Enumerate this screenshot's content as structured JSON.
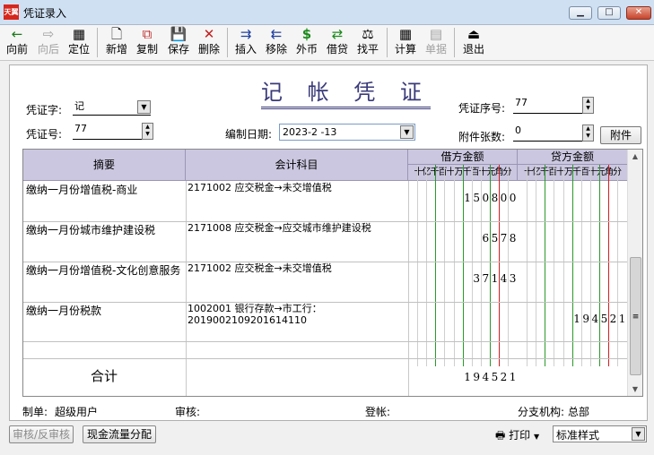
{
  "window": {
    "title": "凭证录入",
    "logo_text": "天翼"
  },
  "toolbar": [
    {
      "key": "back",
      "label": "向前",
      "icon": "←"
    },
    {
      "key": "forward",
      "label": "向后",
      "icon": "⇨",
      "disabled": true
    },
    {
      "key": "locate",
      "label": "定位",
      "icon": "▦"
    },
    {
      "key": "new",
      "label": "新增",
      "icon": "🗋"
    },
    {
      "key": "copy",
      "label": "复制",
      "icon": "⧉"
    },
    {
      "key": "save",
      "label": "保存",
      "icon": "💾"
    },
    {
      "key": "delete",
      "label": "删除",
      "icon": "✕"
    },
    {
      "key": "insert",
      "label": "插入",
      "icon": "⇉"
    },
    {
      "key": "remove",
      "label": "移除",
      "icon": "⇇"
    },
    {
      "key": "forex",
      "label": "外币",
      "icon": "$"
    },
    {
      "key": "debit",
      "label": "借贷",
      "icon": "⇄"
    },
    {
      "key": "balance",
      "label": "找平",
      "icon": "⚖"
    },
    {
      "key": "calc",
      "label": "计算",
      "icon": "▦"
    },
    {
      "key": "receipt",
      "label": "单据",
      "icon": "▤",
      "disabled": true
    },
    {
      "key": "exit",
      "label": "退出",
      "icon": "⏏"
    }
  ],
  "voucher": {
    "title": "记 帐 凭 证",
    "word_label": "凭证字:",
    "word_value": "记",
    "seq_label": "凭证序号:",
    "seq_value": "77",
    "no_label": "凭证号:",
    "no_value": "77",
    "date_label": "编制日期:",
    "date_value": "2023-2 -13",
    "attach_label": "附件张数:",
    "attach_value": "0",
    "attach_button": "附件"
  },
  "table": {
    "headers": {
      "summary": "摘要",
      "account": "会计科目",
      "debit": "借方金额",
      "credit": "贷方金额"
    },
    "digit_headers": [
      "十",
      "亿",
      "千",
      "百",
      "十",
      "万",
      "千",
      "百",
      "十",
      "元",
      "角",
      "分"
    ],
    "rows": [
      {
        "summary": "缴纳一月份增值税-商业",
        "account": "2171002  应交税金→未交增值税",
        "debit": "150800",
        "credit": ""
      },
      {
        "summary": "缴纳一月份城市维护建设税",
        "account": "2171008  应交税金→应交城市维护建设税",
        "debit": "6578",
        "credit": ""
      },
      {
        "summary": "缴纳一月份增值税-文化创意服务",
        "account": "2171002  应交税金→未交增值税",
        "debit": "37143",
        "credit": ""
      },
      {
        "summary": "缴纳一月份税款",
        "account": "1002001  银行存款→市工行：2019002109201614110",
        "debit": "",
        "credit": "194521"
      }
    ],
    "total": {
      "label": "合计",
      "debit": "194521",
      "credit": ""
    }
  },
  "footer": {
    "maker_label": "制单:",
    "maker_value": "超级用户",
    "audit_label": "审核:",
    "post_label": "登帐:",
    "branch_label": "分支机构:",
    "branch_value": "总部"
  },
  "bottom": {
    "audit_button": "审核/反审核",
    "cashflow_button": "现金流量分配",
    "print_label": "打印",
    "style_value": "标准样式"
  }
}
